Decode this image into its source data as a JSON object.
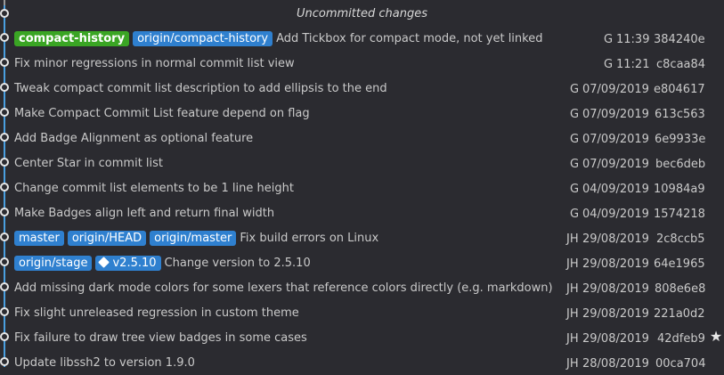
{
  "header": {
    "title": "Uncommitted changes"
  },
  "commits": [
    {
      "badges": [
        {
          "label": "compact-history",
          "kind": "current"
        },
        {
          "label": "origin/compact-history",
          "kind": "local"
        }
      ],
      "message": "Add Tickbox for compact mode, not yet linked",
      "author": "G",
      "date": "11:39",
      "sha": "384240e"
    },
    {
      "badges": [],
      "message": "Fix minor regressions in normal commit list view",
      "author": "G",
      "date": "11:21",
      "sha": "c8caa84"
    },
    {
      "badges": [],
      "message": "Tweak compact commit list description to add ellipsis to the end",
      "author": "G",
      "date": "07/09/2019",
      "sha": "e804617"
    },
    {
      "badges": [],
      "message": "Make Compact Commit List feature depend on flag",
      "author": "G",
      "date": "07/09/2019",
      "sha": "613c563"
    },
    {
      "badges": [],
      "message": "Add Badge Alignment as optional feature",
      "author": "G",
      "date": "07/09/2019",
      "sha": "6e9933e"
    },
    {
      "badges": [],
      "message": "Center Star in commit list",
      "author": "G",
      "date": "07/09/2019",
      "sha": "bec6deb"
    },
    {
      "badges": [],
      "message": "Change commit list elements to be 1 line height",
      "author": "G",
      "date": "04/09/2019",
      "sha": "10984a9"
    },
    {
      "badges": [],
      "message": "Make Badges align left and return final width",
      "author": "G",
      "date": "04/09/2019",
      "sha": "1574218"
    },
    {
      "badges": [
        {
          "label": "master",
          "kind": "local"
        },
        {
          "label": "origin/HEAD",
          "kind": "local"
        },
        {
          "label": "origin/master",
          "kind": "local"
        }
      ],
      "message": "Fix build errors on Linux",
      "author": "JH",
      "date": "29/08/2019",
      "sha": "2c8ccb5"
    },
    {
      "badges": [
        {
          "label": "origin/stage",
          "kind": "local"
        },
        {
          "label": "v2.5.10",
          "kind": "tag"
        }
      ],
      "message": "Change version to 2.5.10",
      "author": "JH",
      "date": "29/08/2019",
      "sha": "64e1965"
    },
    {
      "badges": [],
      "message": "Add missing dark mode colors for some lexers that reference colors directly (e.g. markdown)",
      "author": "JH",
      "date": "29/08/2019",
      "sha": "808e6e8"
    },
    {
      "badges": [],
      "message": "Fix slight unreleased regression in custom theme",
      "author": "JH",
      "date": "29/08/2019",
      "sha": "221a0d2"
    },
    {
      "badges": [],
      "message": "Fix failure to draw tree view badges in some cases",
      "author": "JH",
      "date": "29/08/2019",
      "sha": "42dfeb9",
      "starred": true
    },
    {
      "badges": [],
      "message": "Update libssh2 to version 1.9.0",
      "author": "JH",
      "date": "28/08/2019",
      "sha": "00ca704"
    }
  ],
  "icons": {
    "star": "star-icon",
    "tag": "tag-icon",
    "node": "commit-node-icon"
  },
  "colors": {
    "background": "#2b2b30",
    "graph_line": "#4a9fe0",
    "branch_badge": "#2f80cf",
    "current_branch_badge": "#3aa524",
    "text": "#c9c9c9"
  }
}
